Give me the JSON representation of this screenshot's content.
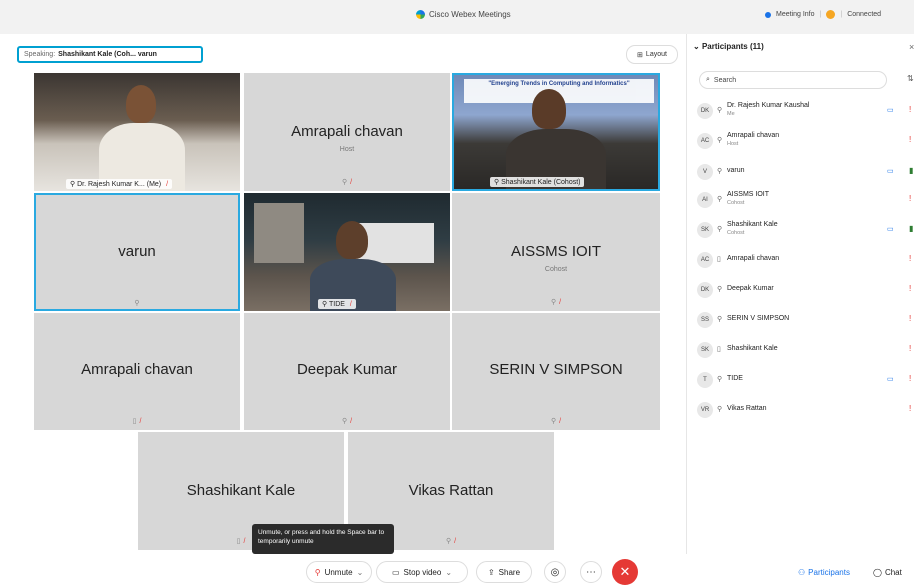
{
  "window": {
    "title": "Cisco Webex Meetings"
  },
  "topbar": {
    "meeting_info": "Meeting Info",
    "status": "Connected"
  },
  "speaking": {
    "label": "Speaking:",
    "value": "Shashikant Kale (Coh... varun"
  },
  "layout_button": {
    "label": "Layout"
  },
  "tiles": [
    {
      "name": "Dr. Rajesh Kumar K...",
      "tag": "(Me)"
    },
    {
      "name": "Amrapali chavan",
      "sub": "Host"
    },
    {
      "name": "Shashikant Kale",
      "tag": "(Cohost)",
      "banner": "\"Emerging Trends in Computing and Informatics\""
    },
    {
      "name": "varun"
    },
    {
      "name": "TIDE"
    },
    {
      "name": "AISSMS IOIT",
      "sub": "Cohost"
    },
    {
      "name": "Amrapali chavan"
    },
    {
      "name": "Deepak Kumar"
    },
    {
      "name": "SERIN V SIMPSON"
    },
    {
      "name": "Shashikant Kale"
    },
    {
      "name": "Vikas Rattan"
    }
  ],
  "tooltip": {
    "text": "Unmute, or press and hold the Space bar to temporarily unmute"
  },
  "controls": {
    "unmute": "Unmute",
    "stop_video": "Stop video",
    "share": "Share"
  },
  "participants": {
    "title": "Participants (11)",
    "search_placeholder": "Search",
    "items": [
      {
        "initials": "DK",
        "name": "Dr. Rajesh Kumar Kaushal",
        "role": "Me"
      },
      {
        "initials": "AC",
        "name": "Amrapali chavan",
        "role": "Host"
      },
      {
        "initials": "V",
        "name": "varun",
        "role": ""
      },
      {
        "initials": "AI",
        "name": "AISSMS IOIT",
        "role": "Cohost"
      },
      {
        "initials": "SK",
        "name": "Shashikant Kale",
        "role": "Cohost"
      },
      {
        "initials": "AC",
        "name": "Amrapali chavan",
        "role": ""
      },
      {
        "initials": "DK",
        "name": "Deepak Kumar",
        "role": ""
      },
      {
        "initials": "SS",
        "name": "SERIN V SIMPSON",
        "role": ""
      },
      {
        "initials": "SK",
        "name": "Shashikant Kale",
        "role": ""
      },
      {
        "initials": "T",
        "name": "TIDE",
        "role": ""
      },
      {
        "initials": "VR",
        "name": "Vikas Rattan",
        "role": ""
      }
    ]
  },
  "footer": {
    "participants_btn": "Participants",
    "chat_btn": "Chat"
  }
}
